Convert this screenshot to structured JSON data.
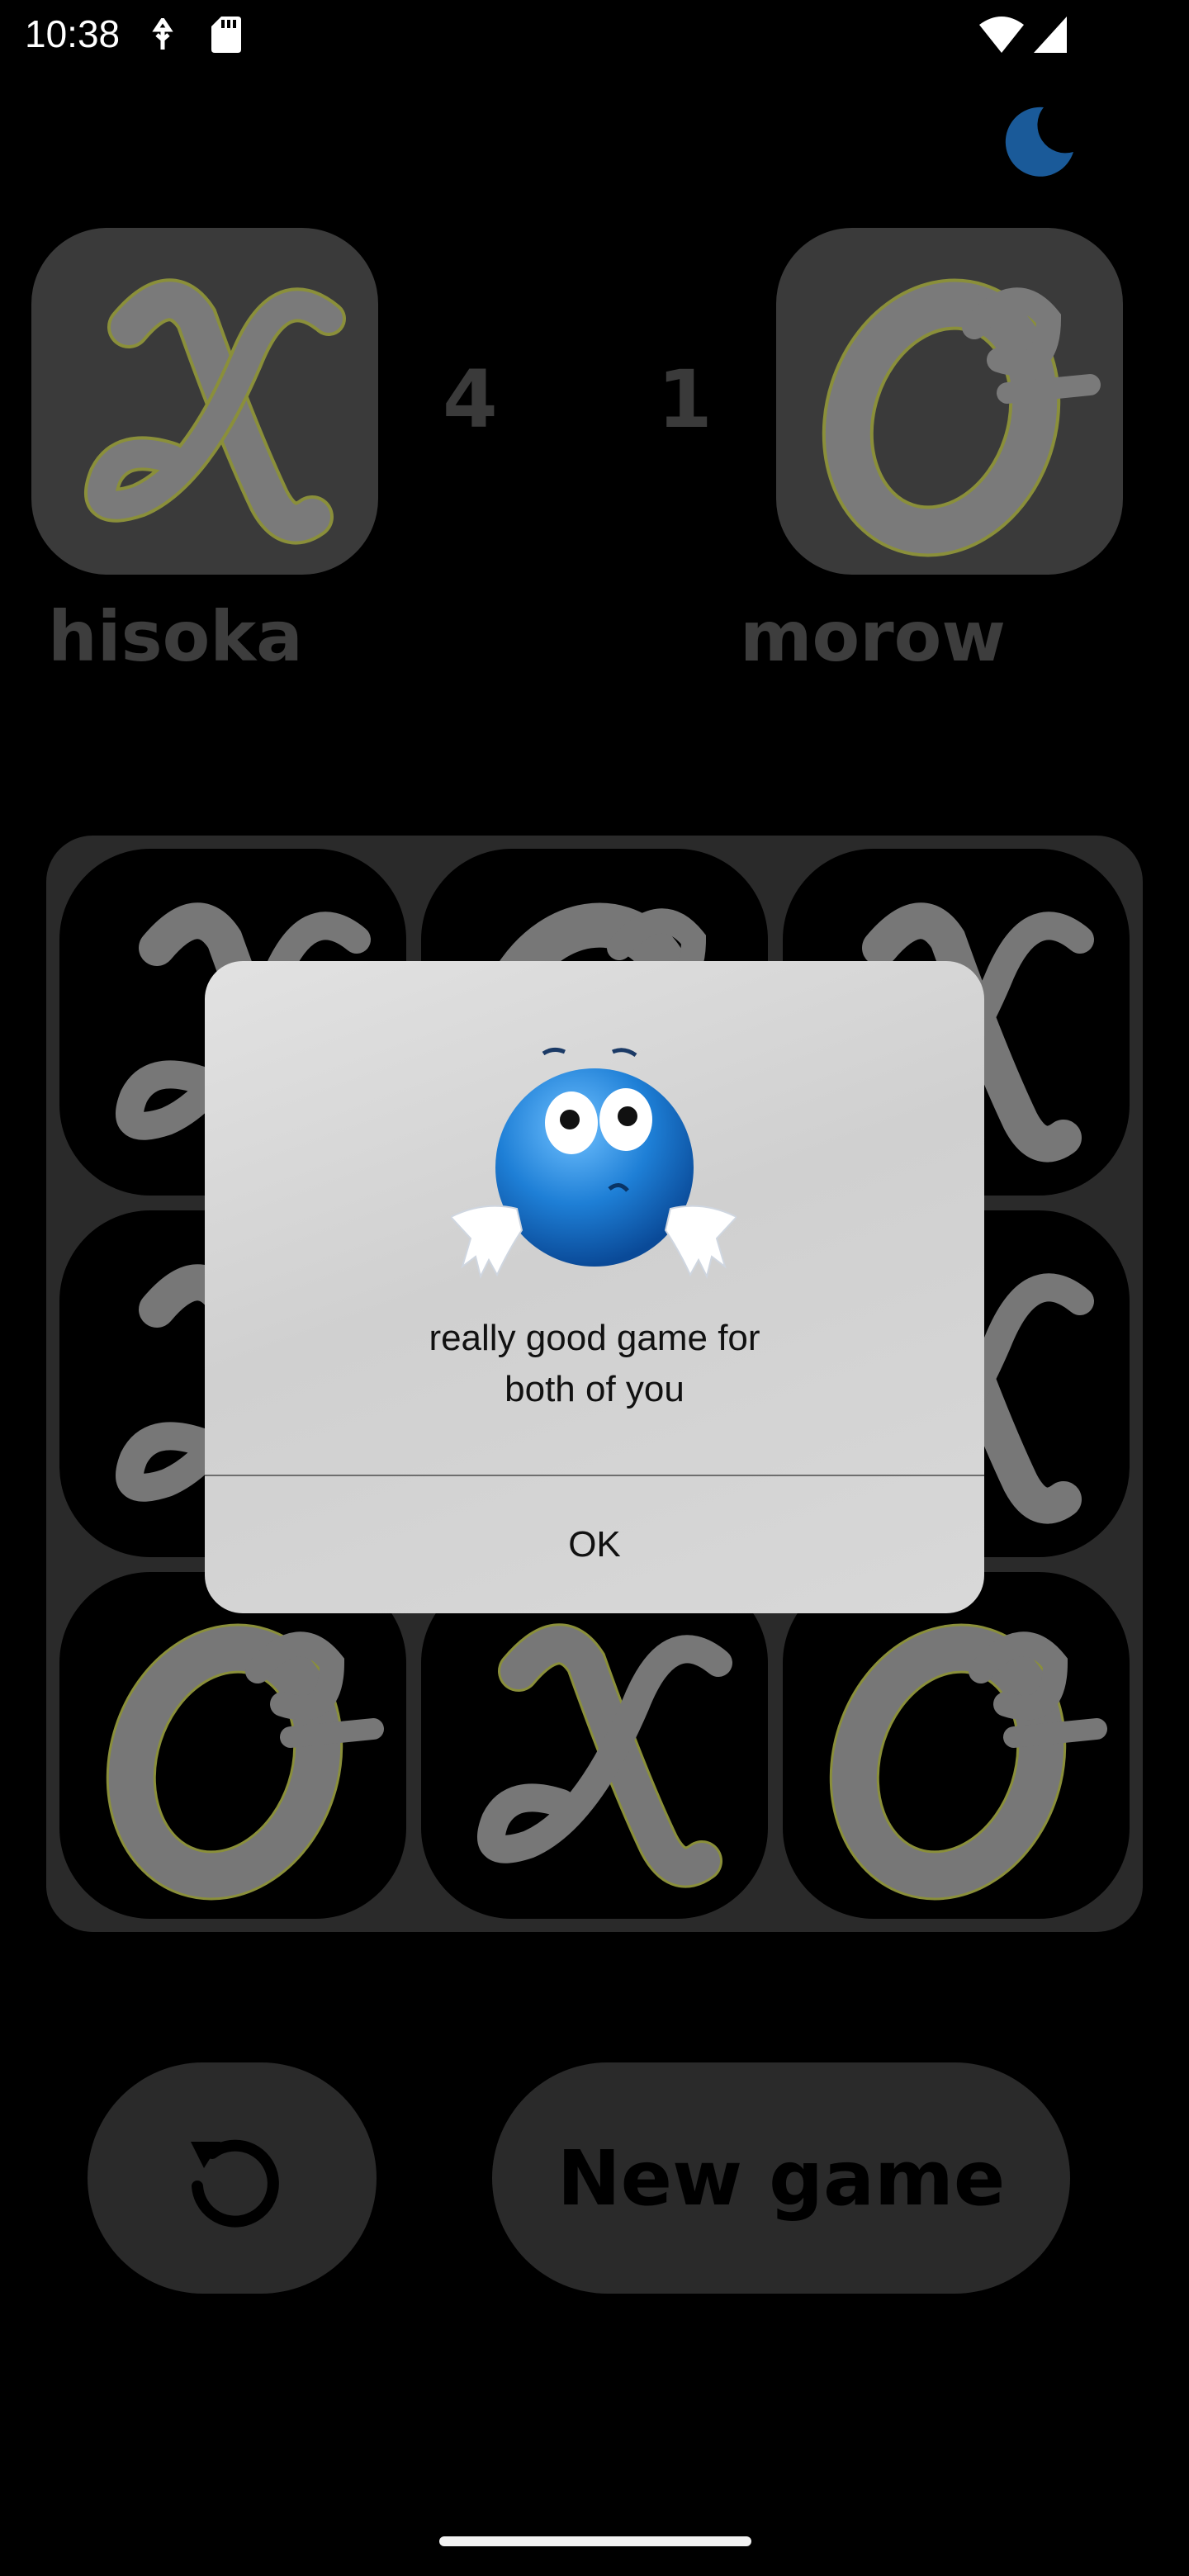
{
  "status_bar": {
    "time": "10:38",
    "icons": [
      "usb-debug-icon",
      "sd-card-icon",
      "wifi-icon",
      "signal-icon"
    ]
  },
  "header": {
    "theme_toggle_icon": "moon-icon"
  },
  "players": {
    "left": {
      "symbol": "X",
      "name": "hisoka",
      "score": "4"
    },
    "right": {
      "symbol": "O",
      "name": "morow",
      "score": "1"
    }
  },
  "board": {
    "cells": [
      "X",
      "O",
      "X",
      "X",
      "",
      "X",
      "O",
      "X",
      "O"
    ]
  },
  "controls": {
    "undo_icon": "undo-icon",
    "new_game_label": "New game"
  },
  "dialog": {
    "emoji_icon": "shrugging-emoji-icon",
    "message": "really good game for\nboth of you",
    "ok_label": "OK"
  },
  "colors": {
    "background": "#000000",
    "tile": "#3a3a3a",
    "board": "#2a2a2a",
    "symbol_fill": "#777777",
    "symbol_outline": "#8a8f3a",
    "moon": "#1a5a99",
    "dialog_bg": "#d6d6d6"
  }
}
